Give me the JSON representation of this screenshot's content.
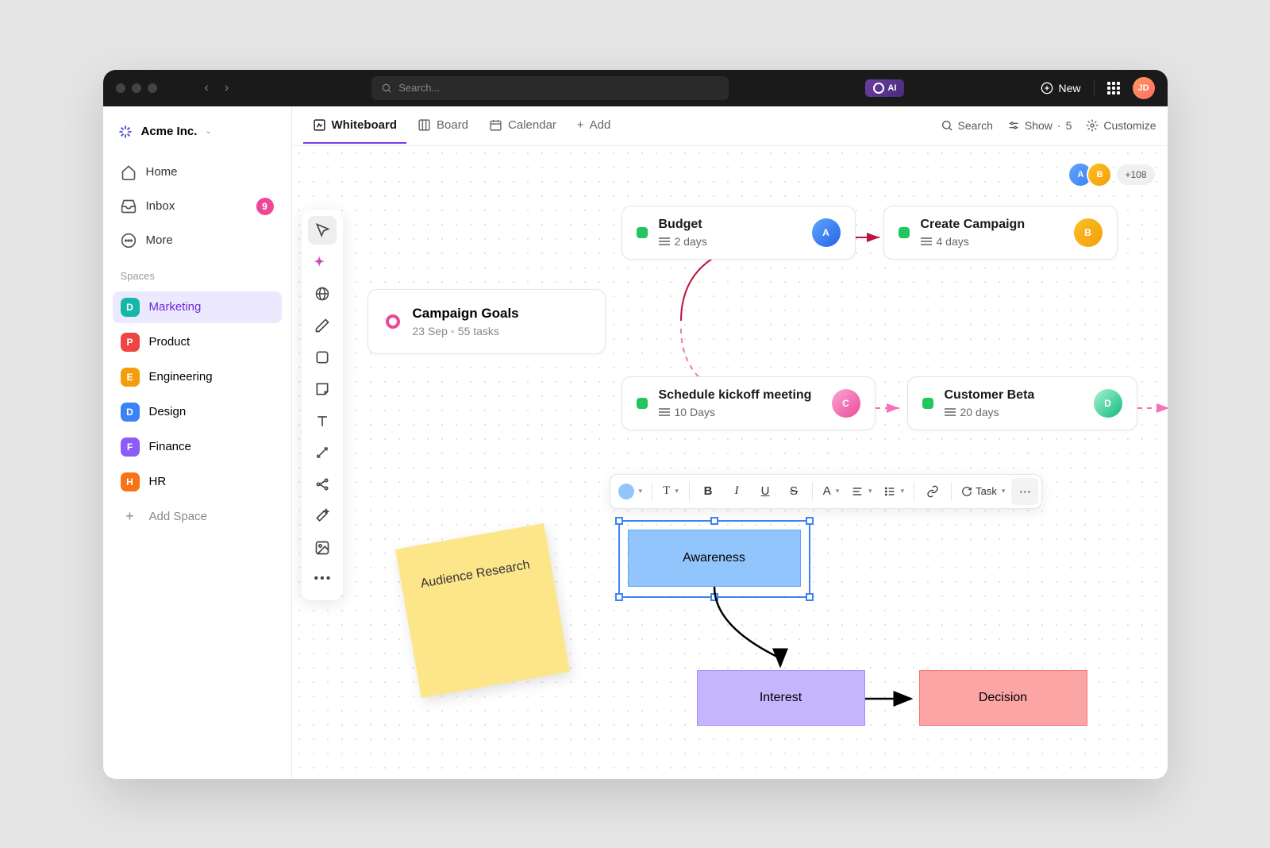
{
  "titlebar": {
    "search_placeholder": "Search...",
    "ai_label": "AI",
    "new_label": "New"
  },
  "sidebar": {
    "workspace_name": "Acme Inc.",
    "nav": {
      "home": "Home",
      "inbox": "Inbox",
      "inbox_count": "9",
      "more": "More"
    },
    "spaces_label": "Spaces",
    "spaces": [
      {
        "letter": "D",
        "name": "Marketing",
        "color": "#14b8a6"
      },
      {
        "letter": "P",
        "name": "Product",
        "color": "#ef4444"
      },
      {
        "letter": "E",
        "name": "Engineering",
        "color": "#f59e0b"
      },
      {
        "letter": "D",
        "name": "Design",
        "color": "#3b82f6"
      },
      {
        "letter": "F",
        "name": "Finance",
        "color": "#8b5cf6"
      },
      {
        "letter": "H",
        "name": "HR",
        "color": "#f97316"
      }
    ],
    "add_space": "Add Space"
  },
  "tabs": {
    "whiteboard": "Whiteboard",
    "board": "Board",
    "calendar": "Calendar",
    "add": "Add",
    "search": "Search",
    "show": "Show",
    "show_count": "5",
    "customize": "Customize"
  },
  "collaborators": {
    "more_count": "+108"
  },
  "cards": {
    "goals": {
      "title": "Campaign Goals",
      "date": "23 Sep",
      "tasks": "55 tasks"
    },
    "budget": {
      "title": "Budget",
      "duration": "2 days"
    },
    "create": {
      "title": "Create Campaign",
      "duration": "4 days"
    },
    "kickoff": {
      "title": "Schedule kickoff meeting",
      "duration": "10 Days"
    },
    "beta": {
      "title": "Customer Beta",
      "duration": "20 days"
    }
  },
  "sticky": {
    "text": "Audience Research"
  },
  "shapes": {
    "awareness": "Awareness",
    "interest": "Interest",
    "decision": "Decision"
  },
  "format_toolbar": {
    "task_label": "Task",
    "fill_color": "#93c5fd"
  }
}
